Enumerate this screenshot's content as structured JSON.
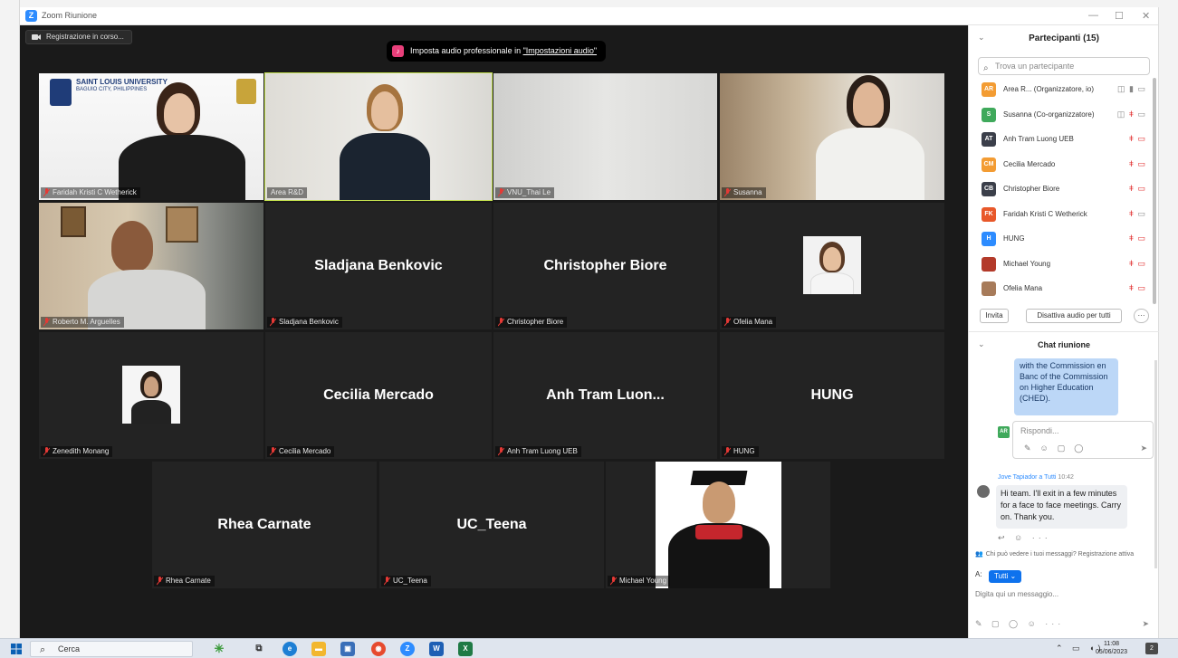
{
  "window": {
    "title": "Zoom Riunione",
    "minimize": "—",
    "maximize": "☐",
    "close": "✕"
  },
  "meeting": {
    "recording_label": "Registrazione in corso...",
    "audio_banner": {
      "prefix": "Imposta audio professionale in ",
      "link": "\"Impostazioni audio\""
    },
    "tiles": [
      {
        "id": "faridah",
        "label": "Faridah Kristi C Wetherick",
        "logo_text": "SAINT LOUIS UNIVERSITY",
        "logo_sub": "BAGUIO CITY, PHILIPPINES"
      },
      {
        "id": "area",
        "label": "Area R&D"
      },
      {
        "id": "vnu",
        "label": "VNU_Thai Le"
      },
      {
        "id": "susanna",
        "label": "Susanna"
      },
      {
        "id": "roberto",
        "label": "Roberto M. Arguelles"
      },
      {
        "id": "sladjana",
        "name": "Sladjana Benkovic",
        "label": "Sladjana Benkovic"
      },
      {
        "id": "christopher",
        "name": "Christopher Biore",
        "label": "Christopher Biore"
      },
      {
        "id": "ofelia",
        "label": "Ofelia Mana"
      },
      {
        "id": "zenedith",
        "label": "Zenedith Monang"
      },
      {
        "id": "cecilia",
        "name": "Cecilia Mercado",
        "label": "Cecilia Mercado"
      },
      {
        "id": "anhtram",
        "name": "Anh Tram Luon...",
        "label": "Anh Tram Luong UEB"
      },
      {
        "id": "hung",
        "name": "HUNG",
        "label": "HUNG"
      },
      {
        "id": "rhea",
        "name": "Rhea Carnate",
        "label": "Rhea Carnate"
      },
      {
        "id": "teena",
        "name": "UC_Teena",
        "label": "UC_Teena"
      },
      {
        "id": "michael",
        "label": "Michael Young"
      }
    ]
  },
  "participants": {
    "title": "Partecipanti (15)",
    "search_placeholder": "Trova un partecipante",
    "list": [
      {
        "initials": "AR",
        "color": "#f39c33",
        "name": "Area R...  (Organizzatore, io)"
      },
      {
        "initials": "S",
        "color": "#3fa95b",
        "name": "Susanna (Co-organizzatore)"
      },
      {
        "initials": "AT",
        "color": "#3b3f4a",
        "name": "Anh Tram Luong UEB"
      },
      {
        "initials": "CM",
        "color": "#f39c33",
        "name": "Cecilia Mercado"
      },
      {
        "initials": "CB",
        "color": "#3b3f4a",
        "name": "Christopher Biore"
      },
      {
        "initials": "FK",
        "color": "#e8582a",
        "name": "Faridah Kristi C Wetherick"
      },
      {
        "initials": "H",
        "color": "#2d8cff",
        "name": "HUNG"
      },
      {
        "initials": "",
        "color": "#b33a2a",
        "name": "Michael Young"
      },
      {
        "initials": "",
        "color": "#a77b5a",
        "name": "Ofelia Mana"
      }
    ],
    "invite_button": "Invita",
    "mute_all_button": "Disattiva audio per tutti",
    "more_button": "···"
  },
  "chat": {
    "title": "Chat riunione",
    "quoted_text": "with the Commission en Banc of the Commission on Higher Education (CHED).",
    "reply_avatar": "AR",
    "reply_placeholder": "Rispondi...",
    "message_sender": "Jove Tapiador a Tutti",
    "message_time": "10:42",
    "message_text": "Hi team. I'll exit in a few minutes for a face to face meetings. Carry on. Thank you.",
    "privacy_note": "Chi può vedere i tuoi messaggi? Registrazione attiva",
    "to_label": "A:",
    "to_value": "Tutti",
    "input_placeholder": "Digita qui un messaggio..."
  },
  "taskbar": {
    "search": "Cerca",
    "time": "11:08",
    "date": "05/06/2023",
    "notifications": "2"
  }
}
